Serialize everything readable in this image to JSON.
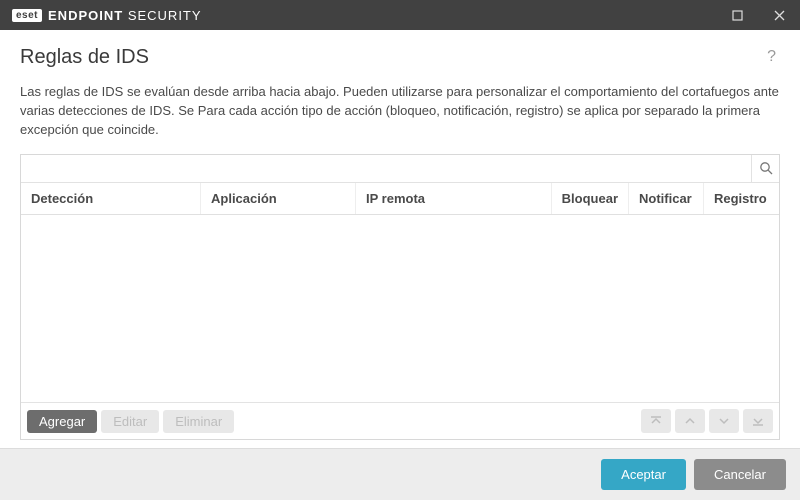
{
  "brand": {
    "badge": "eset",
    "name_bold": "ENDPOINT",
    "name_light": "SECURITY"
  },
  "page": {
    "title": "Reglas de IDS",
    "description": "Las reglas de IDS se evalúan desde arriba hacia abajo. Pueden utilizarse para personalizar el comportamiento del cortafuegos ante varias detecciones de IDS. Se Para cada acción tipo de acción (bloqueo, notificación, registro) se aplica por separado la primera excepción que coincide."
  },
  "search": {
    "value": "",
    "placeholder": ""
  },
  "columns": {
    "deteccion": "Detección",
    "aplicacion": "Aplicación",
    "ip_remota": "IP remota",
    "bloquear": "Bloquear",
    "notificar": "Notificar",
    "registro": "Registro"
  },
  "rows": [],
  "panel_buttons": {
    "agregar": "Agregar",
    "editar": "Editar",
    "eliminar": "Eliminar"
  },
  "footer": {
    "accept": "Aceptar",
    "cancel": "Cancelar"
  },
  "icons": {
    "help": "?",
    "search": "search-icon",
    "maximize": "maximize-icon",
    "close": "close-icon",
    "move_top": "move-top-icon",
    "move_up": "move-up-icon",
    "move_down": "move-down-icon",
    "move_bottom": "move-bottom-icon"
  }
}
